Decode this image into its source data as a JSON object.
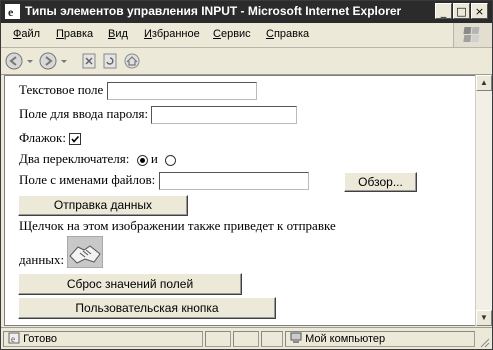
{
  "window": {
    "title": "Типы элементов управления INPUT - Microsoft Internet Explorer",
    "minimize": "_",
    "maximize": "□",
    "close": "×"
  },
  "menu": {
    "items": [
      {
        "first": "Ф",
        "rest": "айл"
      },
      {
        "first": "П",
        "rest": "равка"
      },
      {
        "first": "В",
        "rest": "ид"
      },
      {
        "first": "И",
        "rest": "збранное"
      },
      {
        "first": "С",
        "rest": "ервис"
      },
      {
        "first": "С",
        "rest": "правка"
      }
    ]
  },
  "toolbar": {
    "icons": [
      "back-icon",
      "forward-icon",
      "stop-icon",
      "refresh-icon",
      "home-icon"
    ]
  },
  "form": {
    "text_label": "Текстовое поле",
    "text_value": "",
    "password_label": "Поле для ввода пароля:",
    "password_value": "",
    "checkbox_label": "Флажок:",
    "checkbox_checked": true,
    "radio_label": "Два переключателя:",
    "radio_between": "и",
    "radio1_checked": true,
    "radio2_checked": false,
    "file_label": "Поле с именами файлов:",
    "file_value": "",
    "browse_label": "Обзор...",
    "submit_label": "Отправка данных",
    "image_text_line1": "Щелчок на этом изображении также приведет к отправке",
    "image_text_line2": "данных:",
    "image_icon": "handshake-icon",
    "reset_label": "Сброс значений полей",
    "custom_label": "Пользовательская кнопка"
  },
  "status": {
    "text": "Готово",
    "zone": "Мой компьютер"
  }
}
